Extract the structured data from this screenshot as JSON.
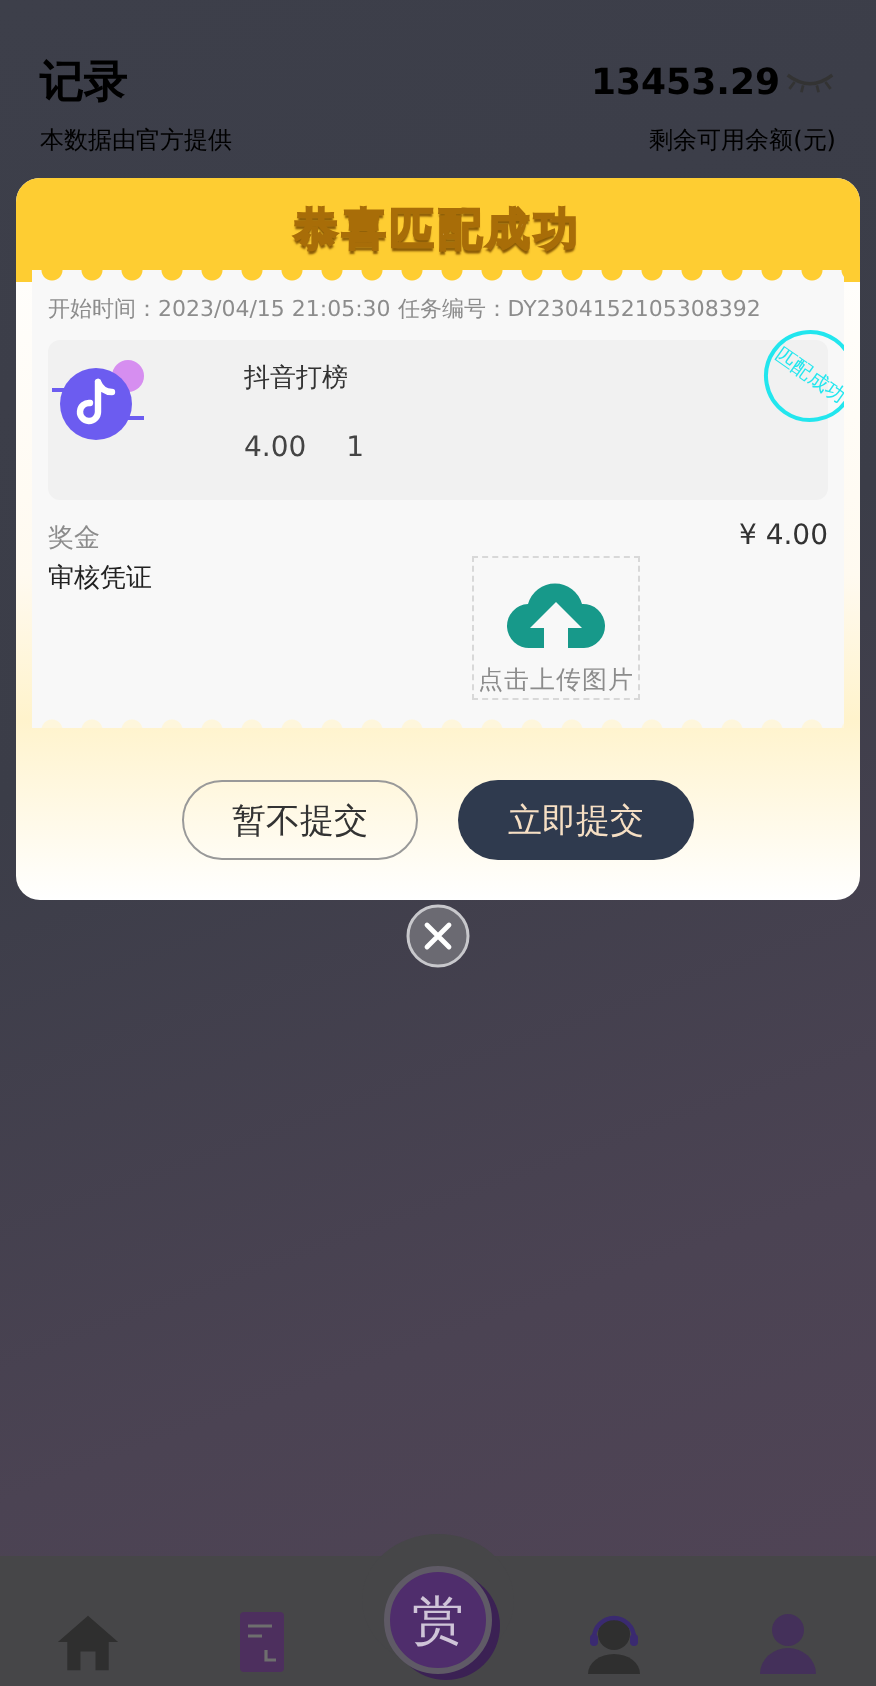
{
  "header": {
    "title": "记录",
    "subtitle": "本数据由官方提供",
    "balance": "13453.29",
    "balance_label": "剩余可用余额(元)"
  },
  "dialog": {
    "title": "恭喜匹配成功",
    "stamp": "匹配成功",
    "info": "开始时间：2023/04/15 21:05:30 任务编号：DY2304152105308392",
    "task": {
      "name": "抖音打榜",
      "price": "4.00",
      "count": "1"
    },
    "reward_label": "奖金",
    "reward": "¥ 4.00",
    "proof_label": "审核凭证",
    "upload_label": "点击上传图片",
    "buttons": [
      {
        "label": "暂不提交",
        "kind": "outline"
      },
      {
        "label": "立即提交",
        "kind": "primary"
      }
    ]
  },
  "nav": {
    "items": [
      {
        "kind": "home"
      },
      {
        "kind": "doc"
      },
      {
        "kind": "center",
        "label": "赏"
      },
      {
        "kind": "service"
      },
      {
        "kind": "profile"
      }
    ]
  }
}
